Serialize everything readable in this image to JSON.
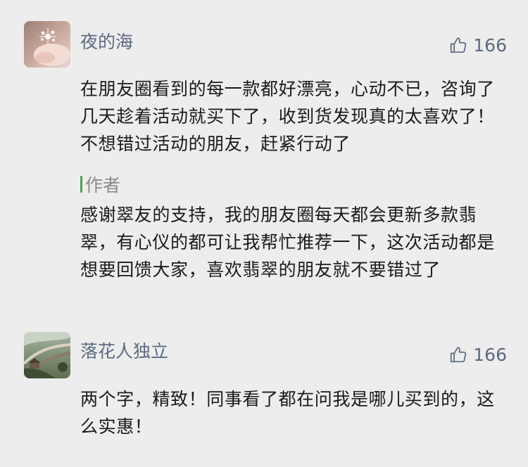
{
  "comments": [
    {
      "nickname": "夜的海",
      "likes": "166",
      "text": "在朋友圈看到的每一款都好漂亮，心动不已，咨询了几天趁着活动就买下了，收到货发现真的太喜欢了！不想错过活动的朋友，赶紧行动了",
      "reply": {
        "author_label": "作者",
        "text": "感谢翠友的支持，我的朋友圈每天都会更新多款翡翠，有心仪的都可让我帮忙推荐一下，这次活动都是想要回馈大家，喜欢翡翠的朋友就不要错过了"
      }
    },
    {
      "nickname": "落花人独立",
      "likes": "166",
      "text": "两个字，精致！同事看了都在问我是哪儿买到的，这么实惠！"
    }
  ],
  "colors": {
    "background": "#ededed",
    "nickname": "#5c6a80",
    "author_bar": "#4aa64e"
  },
  "icons": {
    "like": "thumbs-up-icon"
  }
}
